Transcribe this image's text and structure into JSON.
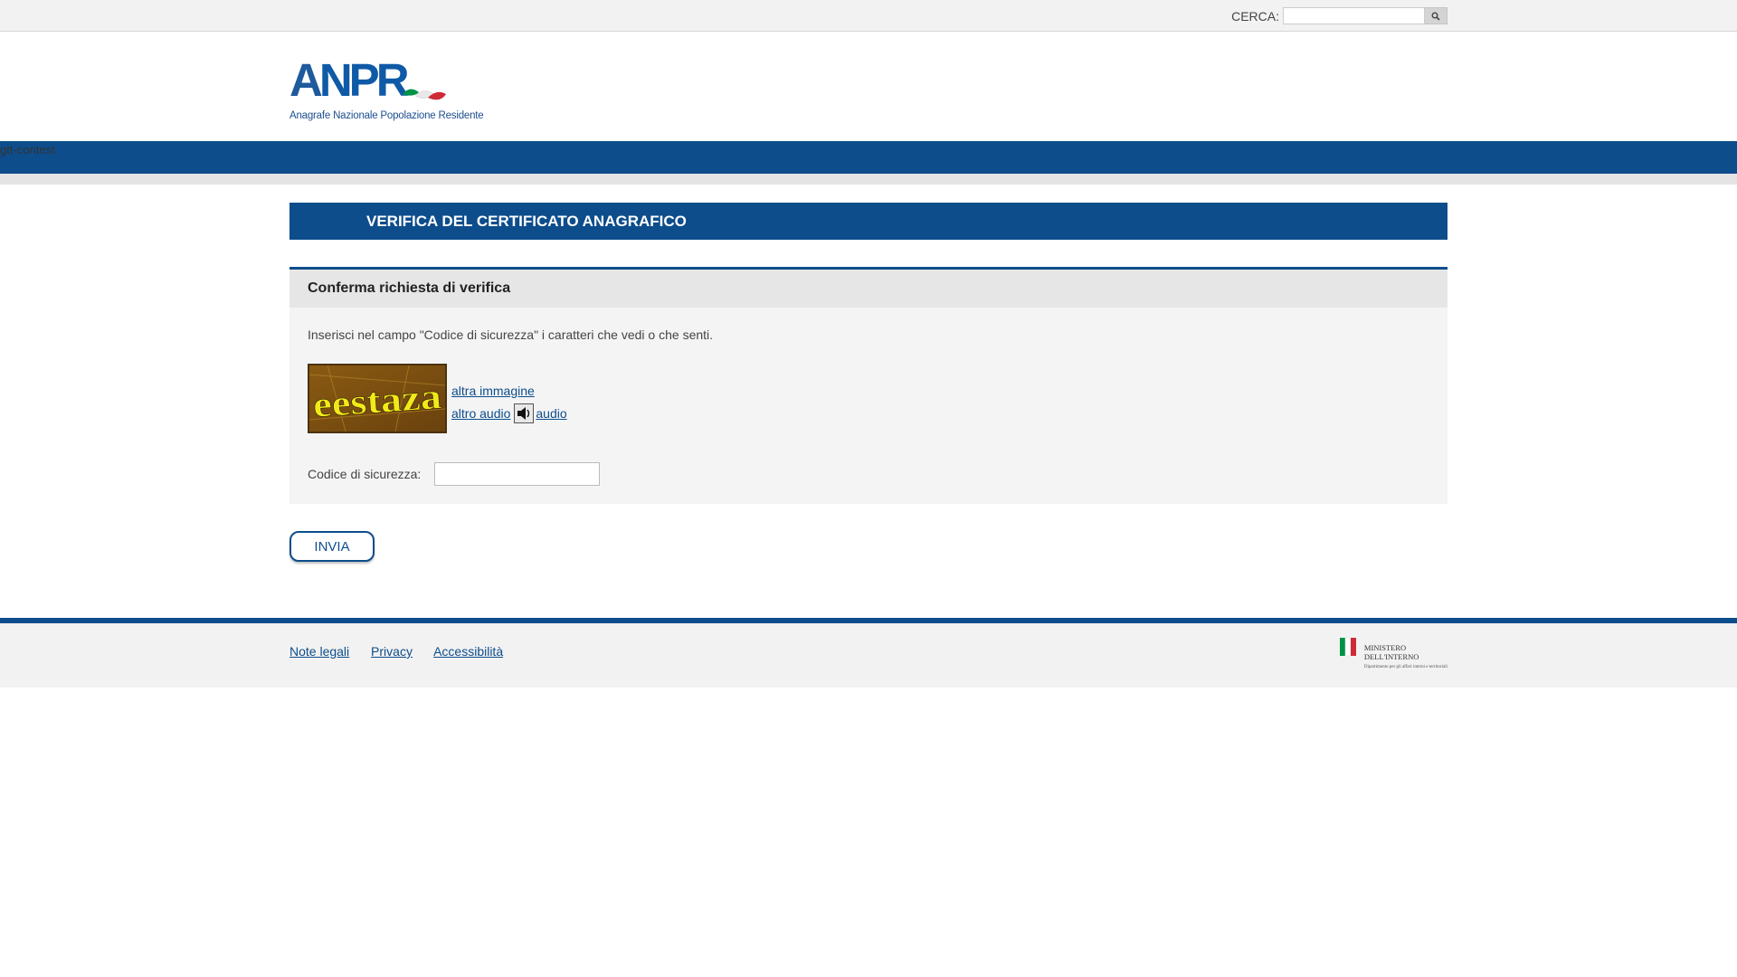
{
  "search": {
    "label": "CERCA:",
    "value": "",
    "placeholder": ""
  },
  "logo": {
    "wordmark_a": "A",
    "wordmark_npr": "NPR",
    "subtitle": "Anagrafe Nazionale Popolazione Residente"
  },
  "nav": {
    "skip_link": "gtt-contest"
  },
  "main": {
    "page_title": "VERIFICA DEL CERTIFICATO ANAGRAFICO",
    "panel_title": "Conferma richiesta di verifica",
    "instructions": "Inserisci nel campo \"Codice di sicurezza\" i caratteri che vedi o che senti.",
    "captcha_text": "eestaza",
    "link_other_image": "altra immagine",
    "link_other_audio": "altro audio",
    "link_audio": "audio",
    "code_label": "Codice di sicurezza:",
    "code_value": "",
    "submit_label": "INVIA"
  },
  "footer": {
    "links": [
      "Note legali",
      "Privacy",
      "Accessibilità"
    ],
    "ministry_line1": "MINISTERO",
    "ministry_line2": "DELL'INTERNO",
    "ministry_sub": "Dipartimento per gli affari interni e territoriali"
  },
  "colors": {
    "brand_blue": "#0d4d8c",
    "italy_green": "#009246",
    "italy_red": "#ce2b37"
  }
}
